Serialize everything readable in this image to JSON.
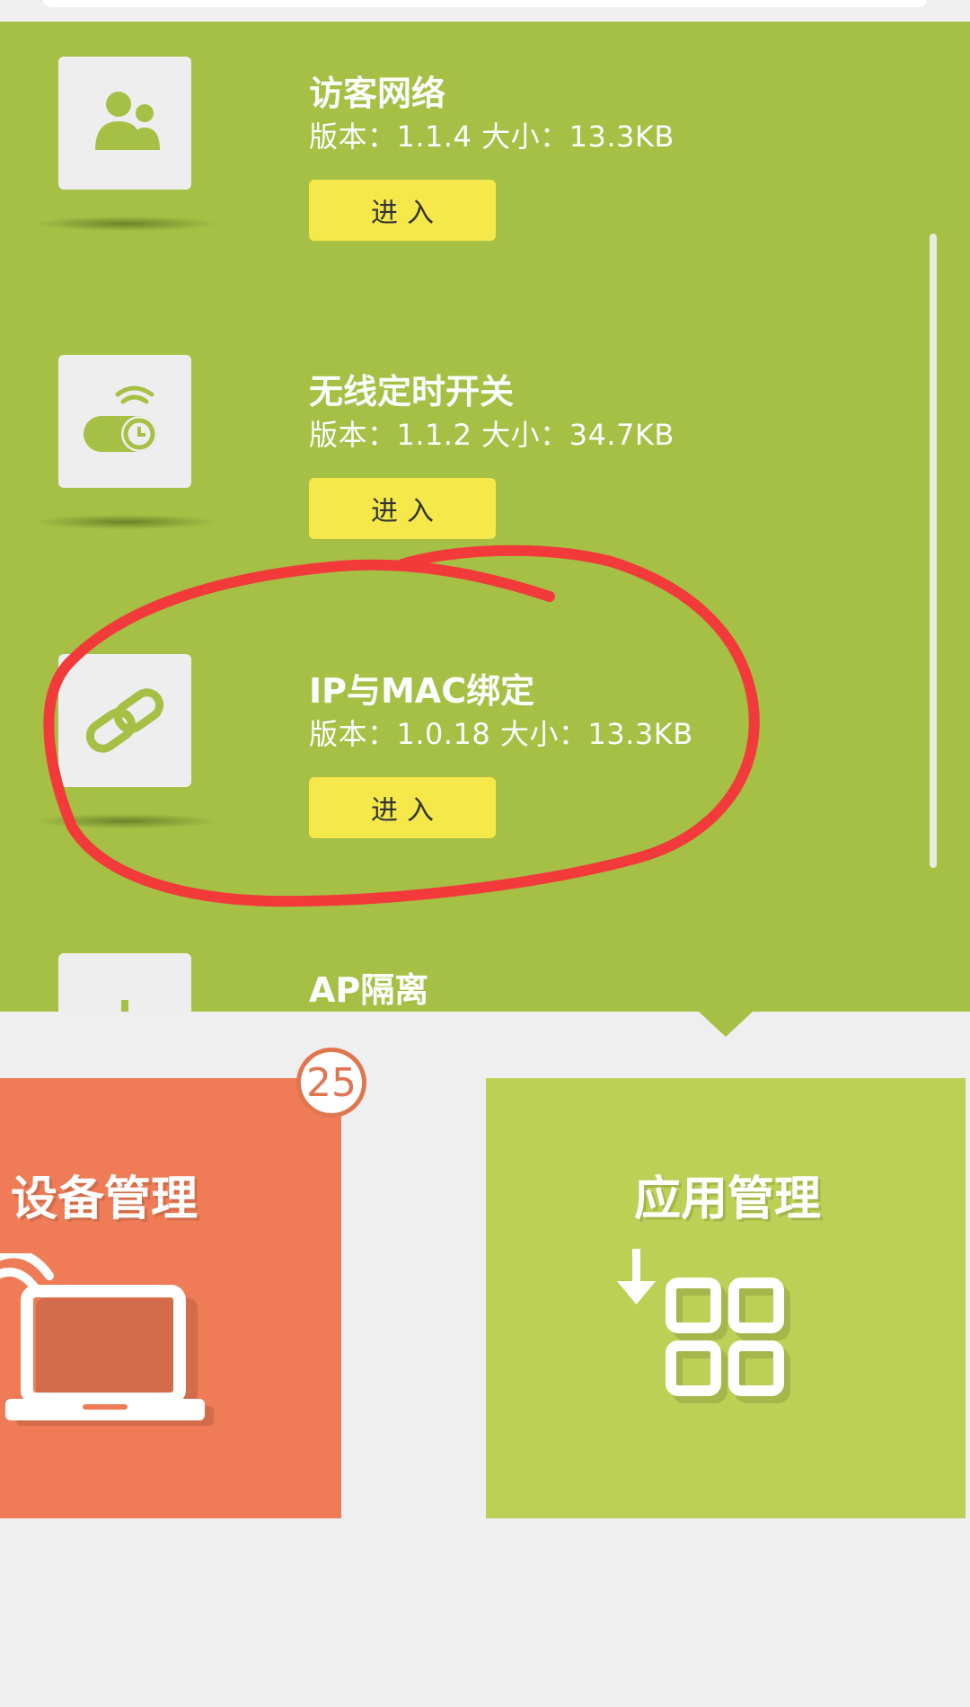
{
  "apps": [
    {
      "name": "访客网络",
      "meta": "版本：1.1.4 大小：13.3KB",
      "button": "进入",
      "icon": "guests-icon"
    },
    {
      "name": "无线定时开关",
      "meta": "版本：1.1.2 大小：34.7KB",
      "button": "进入",
      "icon": "wifi-timer-icon"
    },
    {
      "name": "IP与MAC绑定",
      "meta": "版本：1.0.18 大小：13.3KB",
      "button": "进入",
      "icon": "link-icon"
    },
    {
      "name": "AP隔离",
      "icon": "ap-isolation-icon"
    }
  ],
  "tiles": {
    "device": {
      "title": "设备管理",
      "badge": "25",
      "color": "#ef7c56"
    },
    "apps": {
      "title": "应用管理",
      "color": "#bdd056"
    }
  },
  "colors": {
    "panel": "#a6bf45",
    "button": "#f4e84a",
    "annotation": "#f23a3a",
    "background": "#efefef"
  }
}
